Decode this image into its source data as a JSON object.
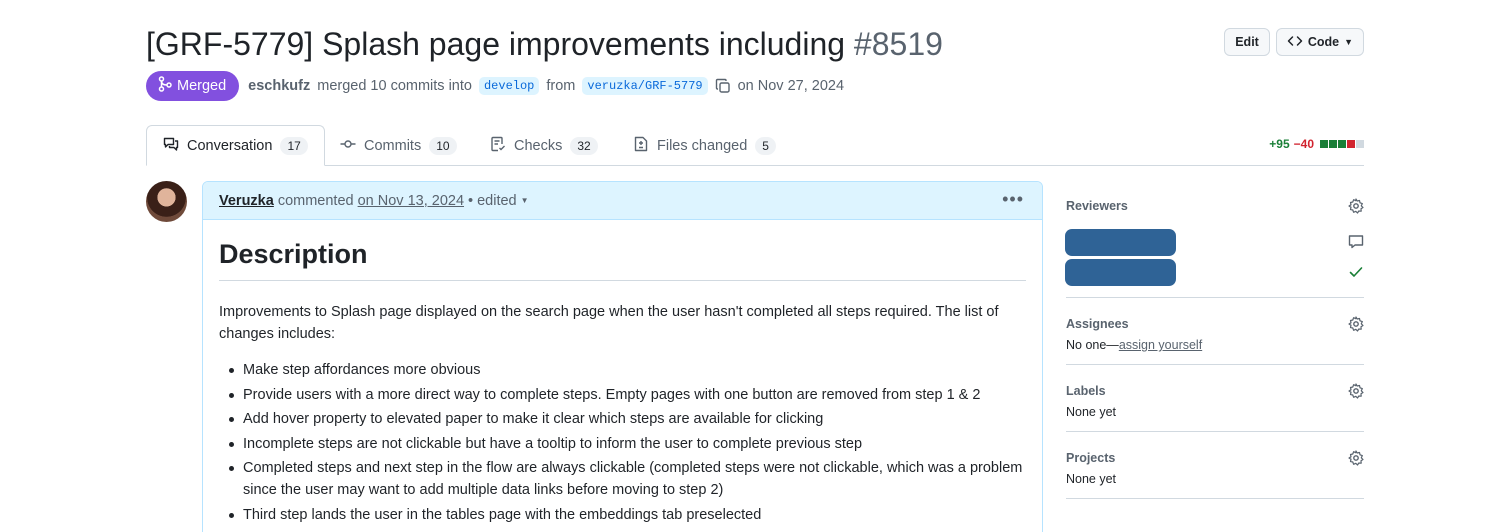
{
  "header": {
    "title": "[GRF-5779] Splash page improvements including",
    "number": "#8519",
    "edit_label": "Edit",
    "code_label": "Code"
  },
  "meta": {
    "state": "Merged",
    "author": "eschkufz",
    "action": "merged 10 commits into",
    "base_branch": "develop",
    "from_word": "from",
    "head_branch": "veruzka/GRF-5779",
    "date": "on Nov 27, 2024"
  },
  "tabs": [
    {
      "label": "Conversation",
      "count": "17",
      "icon": "conversation-icon"
    },
    {
      "label": "Commits",
      "count": "10",
      "icon": "commit-icon"
    },
    {
      "label": "Checks",
      "count": "32",
      "icon": "checklist-icon"
    },
    {
      "label": "Files changed",
      "count": "5",
      "icon": "file-diff-icon"
    }
  ],
  "diffstat": {
    "additions": "+95",
    "deletions": "−40",
    "blocks": [
      "green",
      "green",
      "green",
      "red",
      "gray"
    ],
    "colors": {
      "green": "#1a7f37",
      "red": "#d1242f",
      "gray": "#d1d9e0"
    }
  },
  "comment": {
    "author": "Veruzka",
    "verb": "commented",
    "date": "on Nov 13, 2024",
    "separator": "•",
    "edited": "edited",
    "heading": "Description",
    "intro": "Improvements to Splash page displayed on the search page when the user hasn't completed all steps required. The list of changes includes:",
    "items": [
      "Make step affordances more obvious",
      "Provide users with a more direct way to complete steps. Empty pages with one button are removed from step 1 & 2",
      "Add hover property to elevated paper to make it clear which steps are available for clicking",
      "Incomplete steps are not clickable but have a tooltip to inform the user to complete previous step",
      "Completed steps and next step in the flow are always clickable (completed steps were not clickable, which was a problem since the user may want to add multiple data links before moving to step 2)",
      "Third step lands the user in the tables page with the embeddings tab preselected"
    ]
  },
  "sidebar": {
    "reviewers": {
      "heading": "Reviewers"
    },
    "assignees": {
      "heading": "Assignees",
      "none_prefix": "No one—",
      "assign_link": "assign yourself"
    },
    "labels": {
      "heading": "Labels",
      "value": "None yet"
    },
    "projects": {
      "heading": "Projects",
      "value": "None yet"
    }
  },
  "colors": {
    "merged": "#8250df",
    "accent_blue": "#0969da",
    "comment_header_bg": "#ddf4ff",
    "redacted": "#2f6396"
  }
}
